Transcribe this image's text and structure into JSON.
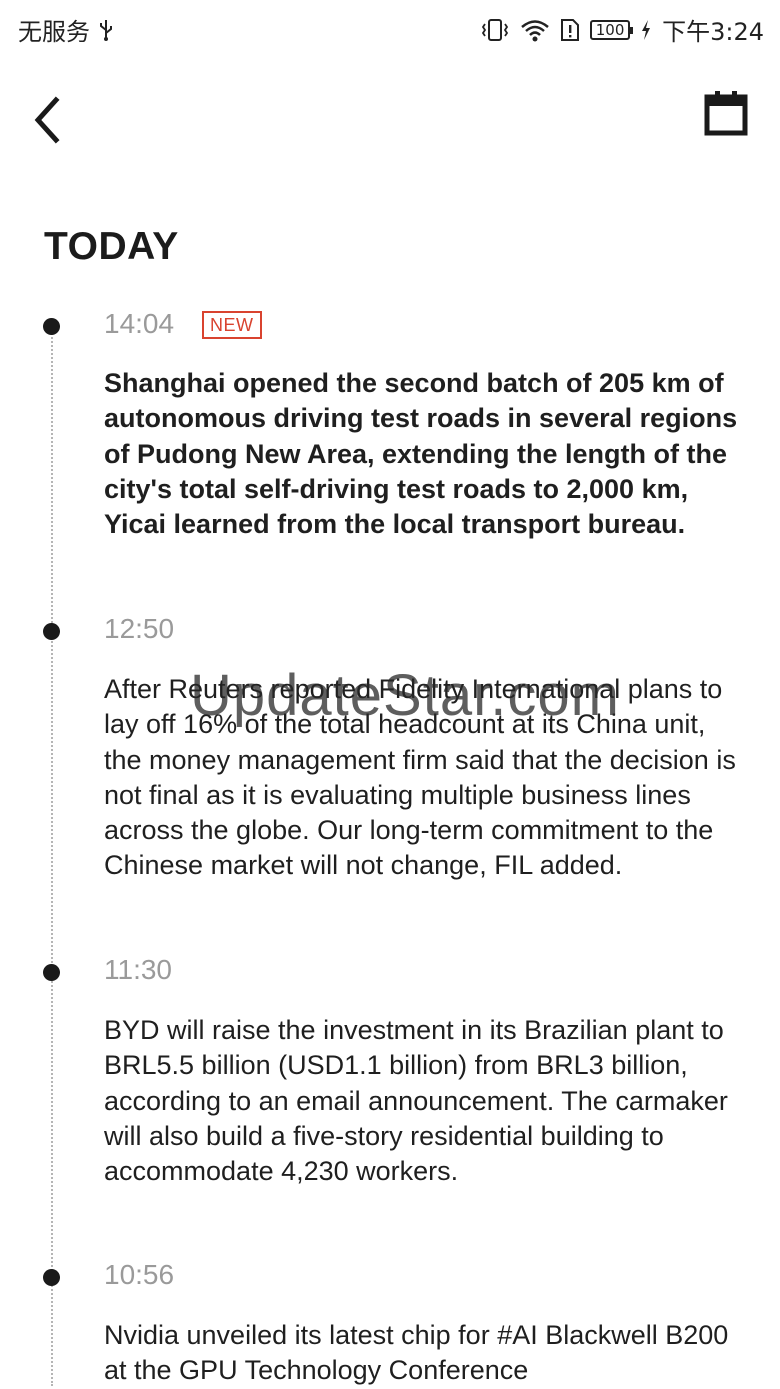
{
  "status_bar": {
    "carrier": "无服务",
    "battery": "100",
    "time": "下午3:24"
  },
  "section_title": "TODAY",
  "news": [
    {
      "time": "14:04",
      "badge": "NEW",
      "bold": true,
      "text": "Shanghai opened the second batch of 205 km of autonomous driving test roads in several regions of Pudong New Area, extending the length of the city's total self-driving test roads to 2,000 km, Yicai learned from the local transport bureau."
    },
    {
      "time": "12:50",
      "text": "After Reuters reported Fidelity International plans to lay off 16% of the total headcount at its China unit, the money management firm said that the decision is not final as it is evaluating multiple business lines across the globe. Our long-term commitment to the Chinese market will not change, FIL added."
    },
    {
      "time": "11:30",
      "text": "BYD will raise the investment in its Brazilian plant to BRL5.5 billion (USD1.1 billion) from BRL3 billion, according to an email announcement. The carmaker will also build a five-story residential building to accommodate 4,230 workers."
    },
    {
      "time": "10:56",
      "text": "Nvidia unveiled its latest chip for #AI Blackwell B200 at the GPU Technology Conference"
    }
  ],
  "watermark": "UpdateStar.com",
  "colors": {
    "accent_new": "#d9432f",
    "time_gray": "#9a9a9a",
    "dot": "#1a1a1a"
  }
}
